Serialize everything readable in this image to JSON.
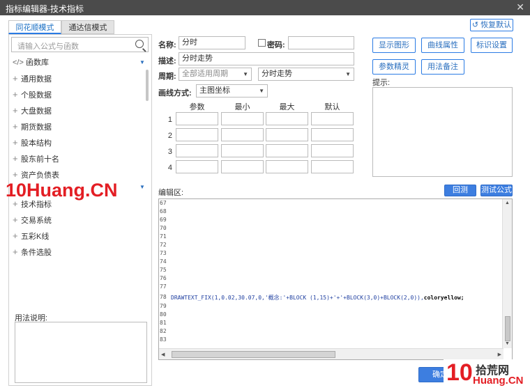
{
  "window": {
    "title": "指标编辑器-技术指标",
    "close_glyph": "✕"
  },
  "tabs": [
    {
      "label": "同花顺模式",
      "active": true
    },
    {
      "label": "通达信模式",
      "active": false
    }
  ],
  "restore_default": "恢复默认",
  "search": {
    "placeholder": "请输入公式与函数"
  },
  "tree": {
    "header": "函数库",
    "items": [
      "通用数据",
      "个股数据",
      "大盘数据",
      "期货数据",
      "股本结构",
      "股东前十名",
      "资产负债表"
    ],
    "items2": [
      "技术指标",
      "交易系统",
      "五彩K线",
      "条件选股"
    ]
  },
  "usage_label": "用法说明:",
  "form": {
    "name_label": "名称:",
    "name_value": "分时",
    "password_label": "密码:",
    "desc_label": "描述:",
    "desc_value": "分时走势",
    "period_label": "周期:",
    "period_value": "全部适用周期",
    "period2_value": "分时走势",
    "draw_label": "画线方式:",
    "draw_value": "主图坐标"
  },
  "buttons": {
    "show_graph": "显示图形",
    "curve_attr": "曲线属性",
    "mark_setting": "标识设置",
    "param_wizard": "参数精灵",
    "usage_note": "用法备注",
    "backtest": "回测",
    "test_formula": "测试公式",
    "confirm": "确定"
  },
  "hint_label": "提示:",
  "param_grid": {
    "headers": [
      "参数",
      "最小",
      "最大",
      "默认"
    ],
    "rows": [
      "1",
      "2",
      "3",
      "4"
    ]
  },
  "editor_label": "编辑区:",
  "editor_lines": [
    "67",
    "68",
    "69",
    "70",
    "71",
    "72",
    "73",
    "74",
    "75",
    "76",
    "77",
    "78",
    "79",
    "80",
    "81",
    "82",
    "83"
  ],
  "code_line": "DRAWTEXT_FIX(1,0.02,30.07,0,'概念:'+BLOCK (1,15)+'+'+BLOCK(3,0)+BLOCK(2,0)),",
  "code_color": "coloryellow;",
  "watermark": {
    "left": "10Huang.CN",
    "brand": "拾荒网",
    "brand_prefix": "10",
    "brand_sub": "Huang.CN"
  }
}
